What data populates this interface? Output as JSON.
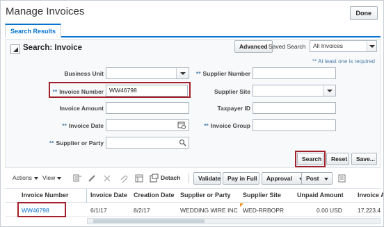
{
  "page": {
    "title": "Manage Invoices",
    "done_label": "Done",
    "tabs": [
      {
        "label": "Search Results"
      }
    ]
  },
  "search": {
    "title": "Search: Invoice",
    "advanced_label": "Advanced",
    "saved_search_label": "Saved Search",
    "saved_search_value": "All Invoices",
    "required_note": "** At least one is required",
    "required_marker": "**",
    "fields": {
      "business_unit": {
        "label": "Business Unit",
        "value": ""
      },
      "invoice_number": {
        "label": "Invoice Number",
        "value": "WW46798"
      },
      "invoice_amount": {
        "label": "Invoice Amount",
        "value": ""
      },
      "invoice_date": {
        "label": "Invoice Date",
        "value": ""
      },
      "supplier_or_party": {
        "label": "Supplier or Party",
        "value": ""
      },
      "supplier_number": {
        "label": "Supplier Number",
        "value": ""
      },
      "supplier_site": {
        "label": "Supplier Site",
        "value": ""
      },
      "taxpayer_id": {
        "label": "Taxpayer ID",
        "value": ""
      },
      "invoice_group": {
        "label": "Invoice Group",
        "value": ""
      }
    },
    "buttons": {
      "search": "Search",
      "reset": "Reset",
      "save": "Save..."
    }
  },
  "toolbar": {
    "actions": "Actions",
    "view": "View",
    "detach": "Detach",
    "validate": "Validate",
    "pay_in_full": "Pay in Full",
    "approval": "Approval",
    "post": "Post"
  },
  "table": {
    "columns": [
      "Invoice Number",
      "Invoice Date",
      "Creation Date",
      "Supplier or Party",
      "Supplier Site",
      "Unpaid Amount",
      "Invoice A"
    ],
    "rows": [
      [
        "WW46798",
        "6/1/17",
        "8/2/17",
        "WEDDING WIRE INC",
        "WED-RRBOPR",
        "0.00 USD",
        "17,223.4"
      ]
    ]
  },
  "colors": {
    "accent": "#0572ce",
    "highlight": "#a3202a",
    "required": "#4d7fa8"
  }
}
